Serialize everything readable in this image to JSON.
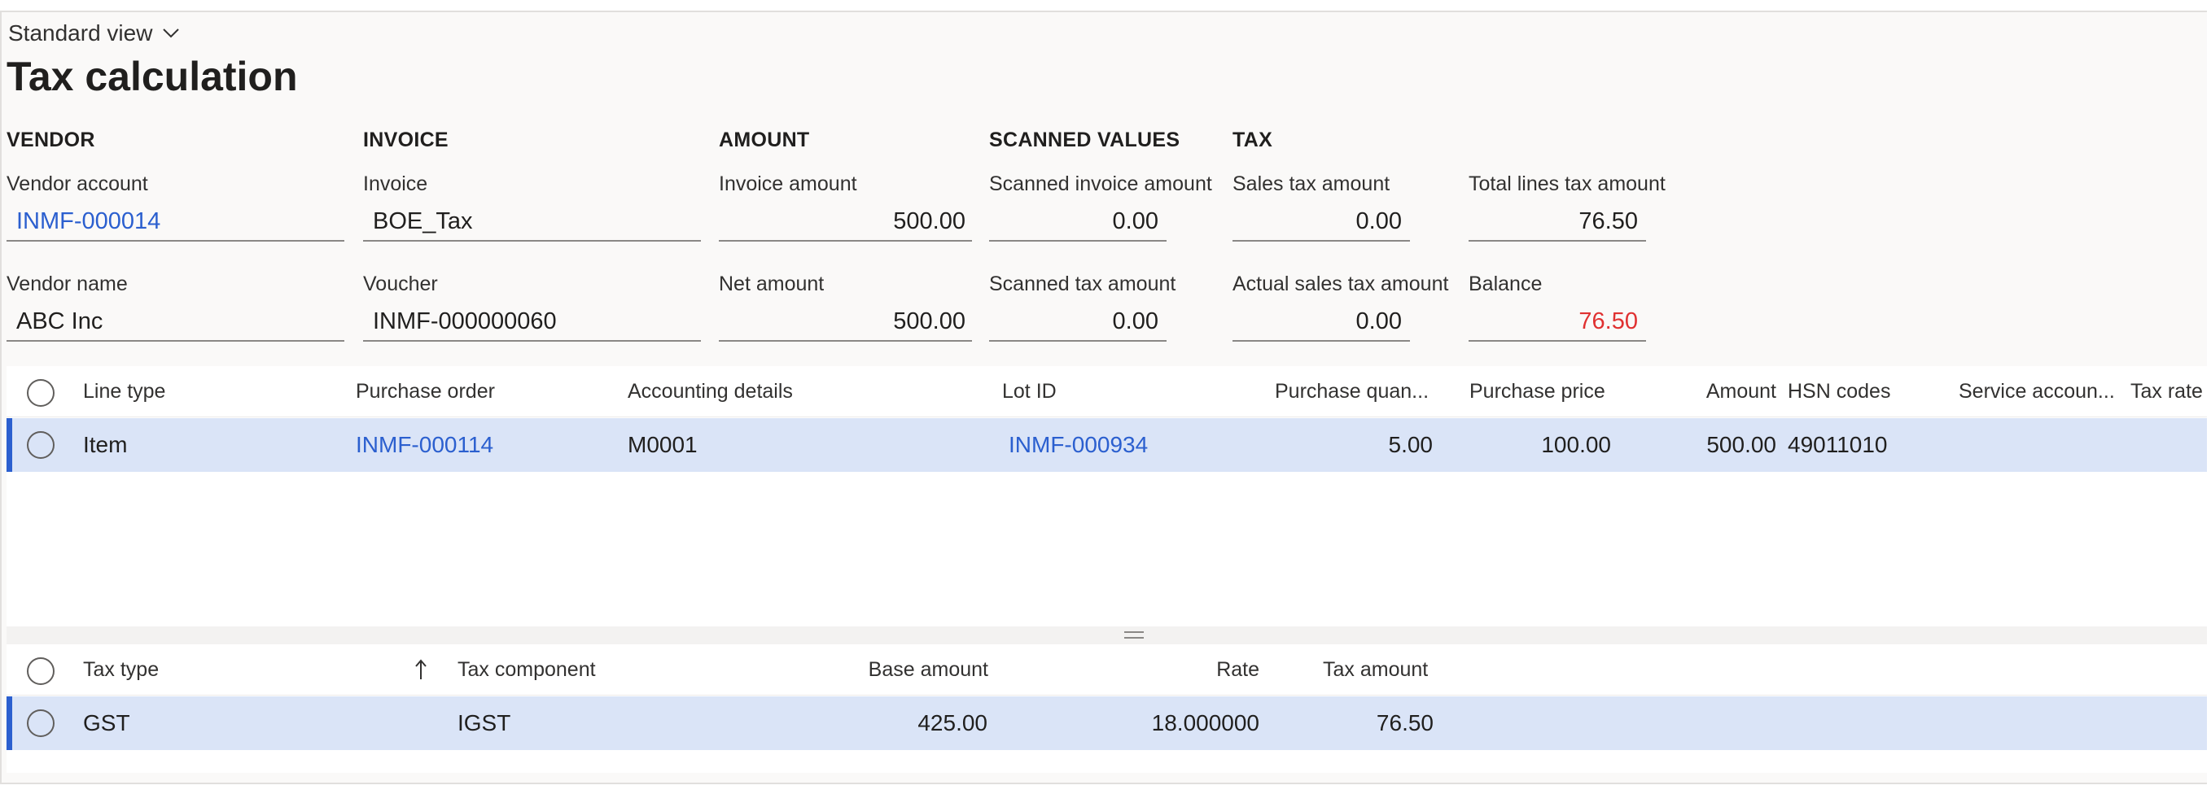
{
  "header": {
    "view_label": "Standard view",
    "view_icon": "chevron-down-icon",
    "title": "Tax calculation"
  },
  "sections": {
    "vendor": "VENDOR",
    "invoice": "INVOICE",
    "amount": "AMOUNT",
    "scanned": "SCANNED VALUES",
    "tax": "TAX"
  },
  "fields": {
    "vendor_account": {
      "label": "Vendor account",
      "value": "INMF-000014"
    },
    "vendor_name": {
      "label": "Vendor name",
      "value": "ABC Inc"
    },
    "invoice": {
      "label": "Invoice",
      "value": "BOE_Tax"
    },
    "voucher": {
      "label": "Voucher",
      "value": "INMF-000000060"
    },
    "invoice_amount": {
      "label": "Invoice amount",
      "value": "500.00"
    },
    "net_amount": {
      "label": "Net amount",
      "value": "500.00"
    },
    "scanned_invoice_amount": {
      "label": "Scanned invoice amount",
      "value": "0.00"
    },
    "scanned_tax_amount": {
      "label": "Scanned tax amount",
      "value": "0.00"
    },
    "sales_tax_amount": {
      "label": "Sales tax amount",
      "value": "0.00"
    },
    "actual_sales_tax_amount": {
      "label": "Actual sales tax amount",
      "value": "0.00"
    },
    "total_lines_tax_amount": {
      "label": "Total lines tax amount",
      "value": "76.50"
    },
    "balance": {
      "label": "Balance",
      "value": "76.50"
    }
  },
  "colors": {
    "link": "#2b5fcf",
    "balance_value": "#e03131",
    "selected_row": "#dae4f7",
    "selection_bar": "#2b5fcf"
  },
  "lines_grid": {
    "columns": [
      "Line type",
      "Purchase order",
      "Accounting details",
      "Lot ID",
      "Purchase quan...",
      "Purchase price",
      "Amount",
      "HSN codes",
      "Service accoun...",
      "Tax rate"
    ],
    "rows": [
      {
        "line_type": "Item",
        "purchase_order": "INMF-000114",
        "accounting_details": "M0001",
        "lot_id": "INMF-000934",
        "purchase_quantity": "5.00",
        "purchase_price": "100.00",
        "amount": "500.00",
        "hsn_codes": "49011010",
        "service_account": "",
        "tax_rate": ""
      }
    ]
  },
  "tax_grid": {
    "columns": [
      "Tax type",
      "Tax component",
      "Base amount",
      "Rate",
      "Tax amount"
    ],
    "sort_icon": "sort-ascending-icon",
    "rows": [
      {
        "tax_type": "GST",
        "tax_component": "IGST",
        "base_amount": "425.00",
        "rate": "18.000000",
        "tax_amount": "76.50"
      }
    ]
  }
}
